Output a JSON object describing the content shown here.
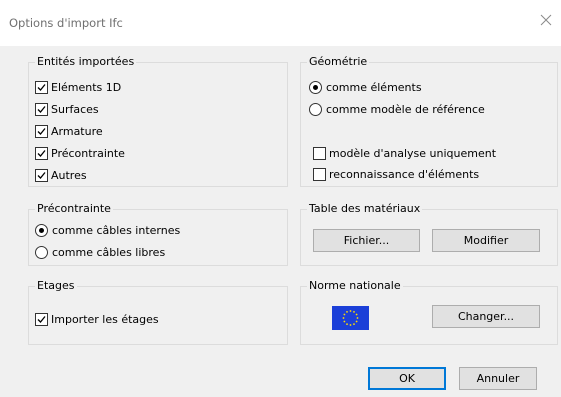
{
  "window": {
    "title": "Options d'import Ifc"
  },
  "entites": {
    "title": "Entités importées",
    "items": [
      {
        "label": "Eléments 1D",
        "checked": true
      },
      {
        "label": "Surfaces",
        "checked": true
      },
      {
        "label": "Armature",
        "checked": true
      },
      {
        "label": "Précontrainte",
        "checked": true
      },
      {
        "label": "Autres",
        "checked": true
      }
    ]
  },
  "geometrie": {
    "title": "Géométrie",
    "radio1": "comme éléments",
    "radio2": "comme modèle de référence",
    "selected": "comme éléments",
    "check1": "modèle d'analyse uniquement",
    "check2": "reconnaissance d'éléments"
  },
  "precontrainte": {
    "title": "Précontrainte",
    "radio1": "comme câbles internes",
    "radio2": "comme câbles libres",
    "selected": "comme câbles internes"
  },
  "materiaux": {
    "title": "Table des matériaux",
    "fichier": "Fichier...",
    "modifier": "Modifier"
  },
  "etages": {
    "title": "Etages",
    "import_label": "Importer les étages",
    "checked": true
  },
  "norme": {
    "title": "Norme nationale",
    "flag_icon": "eu-flag-icon",
    "changer": "Changer..."
  },
  "footer": {
    "ok": "OK",
    "cancel": "Annuler"
  },
  "colors": {
    "accent": "#0078d7",
    "flag_blue": "#1b3fd8",
    "flag_stars": "#ffdd00"
  }
}
